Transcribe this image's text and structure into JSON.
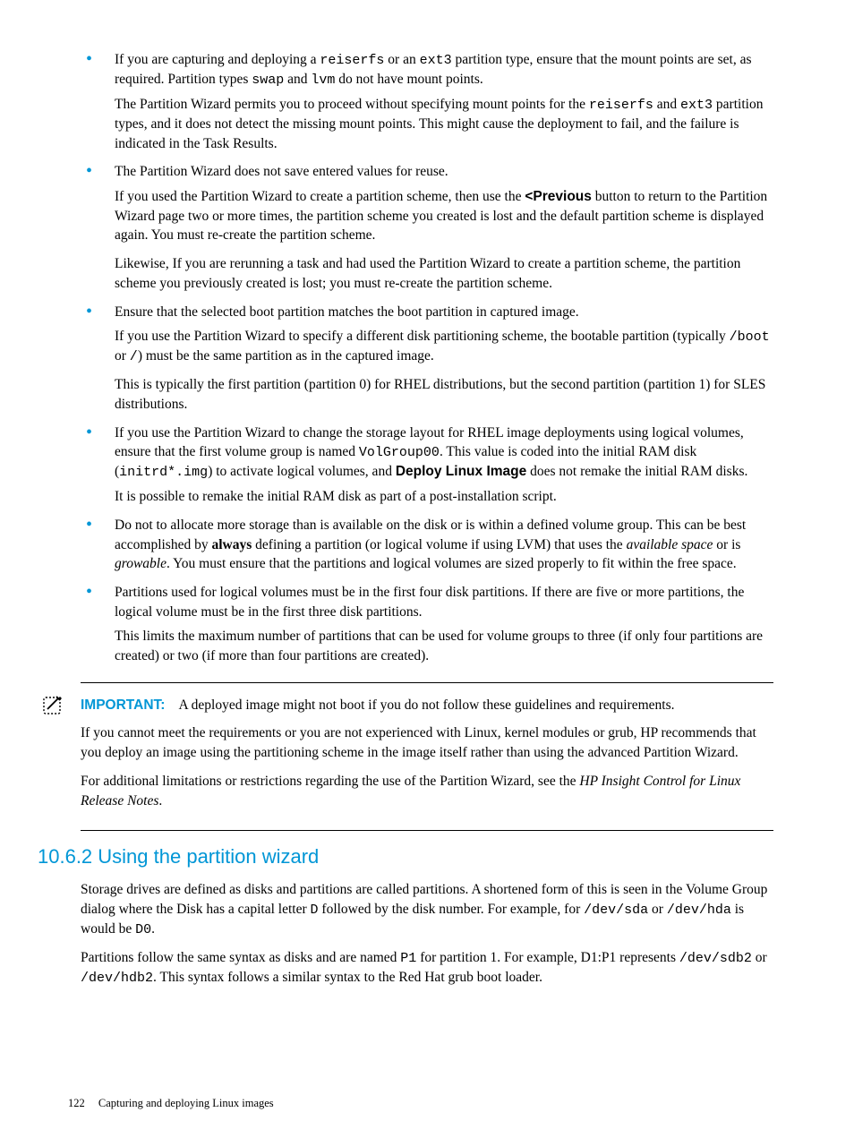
{
  "bullets": [
    {
      "lead_pre": "If you are capturing and deploying a ",
      "mono1": "reiserfs",
      "mid1": " or an ",
      "mono2": "ext3",
      "mid2": " partition type, ensure that the mount points are set, as required. Partition types ",
      "mono3": "swap",
      "mid3": " and ",
      "mono4": "lvm",
      "tail": " do not have mount points.",
      "p2_pre": "The Partition Wizard permits you to proceed without specifying mount points for the ",
      "p2_mono1": "reiserfs",
      "p2_mid1": " and ",
      "p2_mono2": "ext3",
      "p2_tail": " partition types, and it does not detect the missing mount points. This might cause the deployment to fail, and the failure is indicated in the Task Results."
    },
    {
      "lead": "The Partition Wizard does not save entered values for reuse.",
      "p2_pre": "If you used the Partition Wizard to create a partition scheme, then use the ",
      "p2_bold": "<Previous",
      "p2_tail": " button to return to the Partition Wizard page two or more times, the partition scheme you created is lost and the default partition scheme is displayed again. You must re-create the partition scheme.",
      "p3": "Likewise, If you are rerunning a task and had used the Partition Wizard to create a partition scheme, the partition scheme you previously created is lost; you must re-create the partition scheme."
    },
    {
      "lead": "Ensure that the selected boot partition matches the boot partition in captured image.",
      "p2_pre": "If you use the Partition Wizard to specify a different disk partitioning scheme, the bootable partition (typically ",
      "p2_mono1": "/boot",
      "p2_mid1": " or ",
      "p2_mono2": "/",
      "p2_tail": ") must be the same partition as in the captured image.",
      "p3": "This is typically the first partition (partition 0) for RHEL distributions, but the second partition (partition 1) for SLES distributions."
    },
    {
      "lead_pre": "If you use the Partition Wizard to change the storage layout for RHEL image deployments using logical volumes, ensure that the first volume group is named ",
      "mono1": "VolGroup00",
      "mid1": ". This value is coded into the initial RAM disk (",
      "mono2": "initrd*.img",
      "mid2": ") to activate logical volumes, and ",
      "bold1": "Deploy Linux Image",
      "tail": " does not remake the initial RAM disks.",
      "p2": "It is possible to remake the initial RAM disk as part of a post-installation script."
    },
    {
      "lead_pre": "Do not to allocate more storage than is available on the disk or is within a defined volume group. This can be best accomplished by ",
      "bold1": "always",
      "mid1": " defining a partition (or logical volume if using LVM) that uses the ",
      "em1": "available space",
      "mid2": " or is ",
      "em2": "growable",
      "tail": ". You must ensure that the partitions and logical volumes are sized properly to fit within the free space."
    },
    {
      "lead": "Partitions used for logical volumes must be in the first four disk partitions. If there are five or more partitions, the logical volume must be in the first three disk partitions.",
      "p2": "This limits the maximum number of partitions that can be used for volume groups to three (if only four partitions are created) or two (if more than four partitions are created)."
    }
  ],
  "important": {
    "label": "IMPORTANT:",
    "p1": "A deployed image might not boot if you do not follow these guidelines and requirements.",
    "p2": "If you cannot meet the requirements or you are not experienced with Linux, kernel modules or grub, HP recommends that you deploy an image using the partitioning scheme in the image itself rather than using the advanced Partition Wizard.",
    "p3_pre": "For additional limitations or restrictions regarding the use of the Partition Wizard, see the ",
    "p3_em": "HP Insight Control for Linux Release Notes",
    "p3_tail": "."
  },
  "section_heading": "10.6.2 Using the partition wizard",
  "section_body": {
    "p1_pre": "Storage drives are defined as disks and partitions are called partitions. A shortened form of this is seen in the Volume Group dialog where the Disk has a capital letter ",
    "p1_mono1": "D",
    "p1_mid1": " followed by the disk number. For example, for ",
    "p1_mono2": "/dev/sda",
    "p1_mid2": " or ",
    "p1_mono3": "/dev/hda",
    "p1_mid3": " is would be ",
    "p1_mono4": "D0",
    "p1_tail": ".",
    "p2_pre": "Partitions follow the same syntax as disks and are named ",
    "p2_mono1": "P1",
    "p2_mid1": " for partition 1. For example, D1:P1 represents ",
    "p2_mono2": "/dev/sdb2",
    "p2_mid2": " or ",
    "p2_mono3": "/dev/hdb2",
    "p2_tail": ". This syntax follows a similar syntax to the Red Hat grub boot loader."
  },
  "footer": {
    "page_number": "122",
    "chapter": "Capturing and deploying Linux images"
  }
}
